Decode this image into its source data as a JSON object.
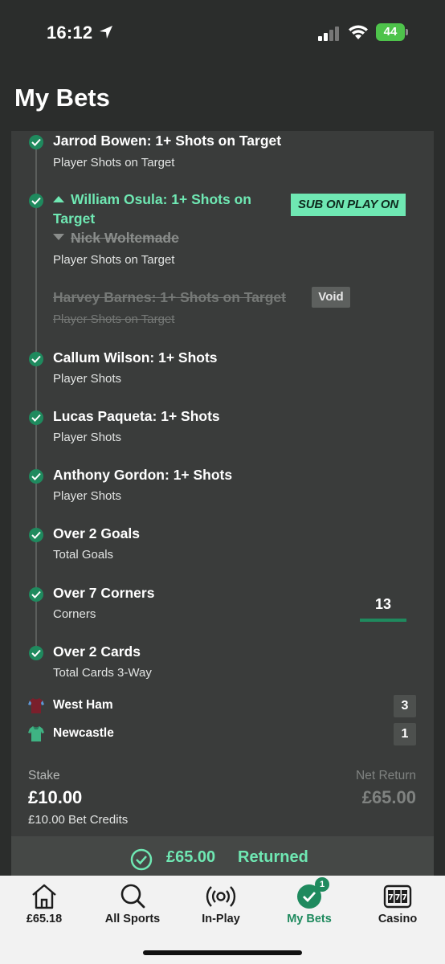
{
  "status_bar": {
    "time": "16:12",
    "battery": "44"
  },
  "page": {
    "title": "My Bets"
  },
  "legs": [
    {
      "title": "Jarrod Bowen: 1+ Shots on Target",
      "market": "Player Shots on Target"
    },
    {
      "title_line1": "William Osula: 1+ Shots on",
      "title_line2": "Target",
      "replaced": "Nick Woltemade",
      "market": "Player Shots on Target",
      "badge": "SUB ON PLAY ON"
    },
    {
      "title": "Harvey Barnes: 1+ Shots on Target",
      "market": "Player Shots on Target",
      "badge": "Void"
    },
    {
      "title": "Callum Wilson: 1+ Shots",
      "market": "Player Shots"
    },
    {
      "title": "Lucas Paqueta: 1+ Shots",
      "market": "Player Shots"
    },
    {
      "title": "Anthony Gordon: 1+ Shots",
      "market": "Player Shots"
    },
    {
      "title": "Over 2 Goals",
      "market": "Total Goals"
    },
    {
      "title": "Over 7 Corners",
      "market": "Corners",
      "count": "13"
    },
    {
      "title": "Over 2 Cards",
      "market": "Total Cards 3-Way"
    }
  ],
  "teams": [
    {
      "name": "West Ham",
      "score": "3"
    },
    {
      "name": "Newcastle",
      "score": "1"
    }
  ],
  "summary": {
    "stake_label": "Stake",
    "stake": "£10.00",
    "credits": "£10.00 Bet Credits",
    "net_label": "Net Return",
    "net_return": "£65.00",
    "returned_amount": "£65.00",
    "returned_text": "Returned"
  },
  "tabs": [
    {
      "label": "£65.18",
      "icon": "home-icon"
    },
    {
      "label": "All Sports",
      "icon": "search-icon"
    },
    {
      "label": "In-Play",
      "icon": "live-icon"
    },
    {
      "label": "My Bets",
      "icon": "check-icon",
      "badge": "1",
      "active": true
    },
    {
      "label": "Casino",
      "icon": "slot-machine-icon"
    }
  ],
  "colors": {
    "accent": "#6fe8b3",
    "brand_green": "#1f8a5e",
    "card": "#3a3c3b",
    "background": "#2b2d2c"
  }
}
